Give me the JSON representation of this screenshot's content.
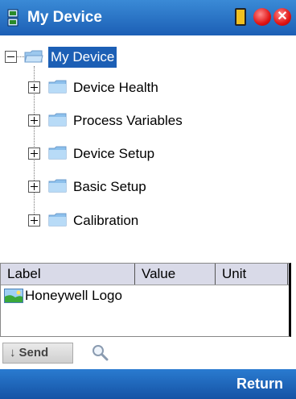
{
  "window": {
    "title": "My Device"
  },
  "tree": {
    "root": {
      "label": "My Device",
      "icon": "folder-open-icon",
      "expanded": true,
      "selected": true
    },
    "children": [
      {
        "label": "Device Health",
        "icon": "folder-icon"
      },
      {
        "label": "Process Variables",
        "icon": "folder-icon"
      },
      {
        "label": "Device Setup",
        "icon": "folder-icon"
      },
      {
        "label": "Basic Setup",
        "icon": "folder-icon"
      },
      {
        "label": "Calibration",
        "icon": "folder-icon"
      }
    ]
  },
  "grid": {
    "columns": [
      "Label",
      "Value",
      "Unit"
    ],
    "rows": [
      {
        "label": "Honeywell Logo",
        "value": "",
        "unit": "",
        "icon": "image-icon"
      }
    ]
  },
  "toolbar": {
    "send_label": "Send",
    "send_icon": "down-arrow-icon",
    "search_icon": "magnifier-icon"
  },
  "softkeys": {
    "right": "Return"
  },
  "colors": {
    "titlebar": "#1c5fb5",
    "selection": "#1c5fb5",
    "grid_header": "#d9dae8"
  }
}
